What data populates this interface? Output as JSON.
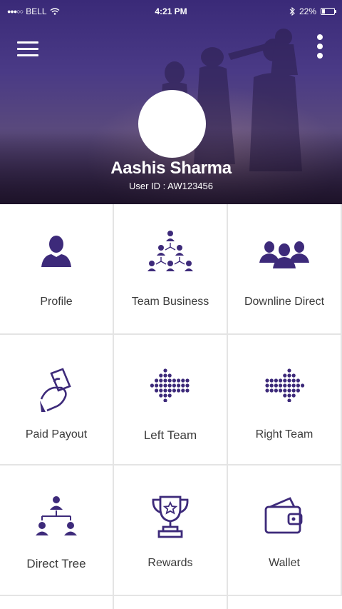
{
  "status_bar": {
    "signal": "●●●○○",
    "carrier": "BELL",
    "time": "4:21 PM",
    "battery": "22%",
    "battery_level": 0.22
  },
  "header": {
    "menu_icon": "hamburger-menu-icon",
    "more_icon": "vertical-ellipsis-icon",
    "user_name": "Aashis Sharma",
    "user_id": "User ID : AW123456"
  },
  "menu": {
    "items": [
      {
        "label": "Profile",
        "icon": "user-icon"
      },
      {
        "label": "Team Business",
        "icon": "team-network-icon"
      },
      {
        "label": "Downline Direct",
        "icon": "group-users-icon"
      },
      {
        "label": "Paid Payout",
        "icon": "hand-money-icon"
      },
      {
        "label": "Left Team",
        "icon": "dotted-arrow-left-icon"
      },
      {
        "label": "Right Team",
        "icon": "dotted-arrow-right-icon"
      },
      {
        "label": "Direct Tree",
        "icon": "hierarchy-tree-icon"
      },
      {
        "label": "Rewards",
        "icon": "trophy-icon"
      },
      {
        "label": "Wallet",
        "icon": "wallet-icon"
      }
    ]
  },
  "colors": {
    "accent": "#3d2a7a",
    "header_top": "#3a2a78",
    "label_text": "#3b3b3b",
    "divider": "#e4e4e4"
  }
}
